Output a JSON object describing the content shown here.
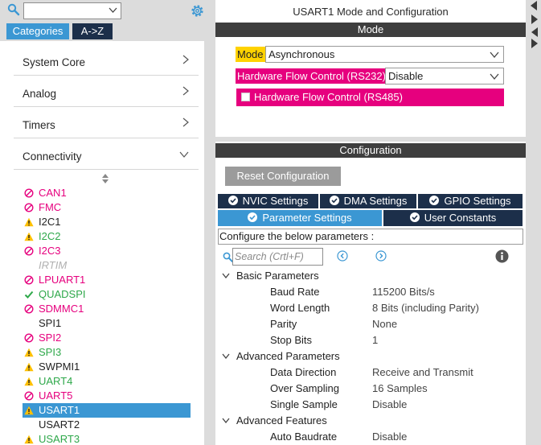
{
  "left": {
    "search": {
      "value": ""
    },
    "tabs": {
      "categories": "Categories",
      "az": "A->Z"
    },
    "categories": [
      {
        "label": "System Core",
        "state": "collapsed"
      },
      {
        "label": "Analog",
        "state": "collapsed"
      },
      {
        "label": "Timers",
        "state": "collapsed"
      },
      {
        "label": "Connectivity",
        "state": "expanded"
      }
    ],
    "peripherals": [
      {
        "label": "CAN1",
        "status": "disabled",
        "color": "#e6007e"
      },
      {
        "label": "FMC",
        "status": "disabled",
        "color": "#e6007e"
      },
      {
        "label": "I2C1",
        "status": "warning",
        "color": "#222222"
      },
      {
        "label": "I2C2",
        "status": "warning",
        "color": "#2ea84a"
      },
      {
        "label": "I2C3",
        "status": "disabled",
        "color": "#e6007e"
      },
      {
        "label": "IRTIM",
        "status": "none",
        "color": "#b0b0b0"
      },
      {
        "label": "LPUART1",
        "status": "disabled",
        "color": "#e6007e"
      },
      {
        "label": "QUADSPI",
        "status": "ok",
        "color": "#2ea84a"
      },
      {
        "label": "SDMMC1",
        "status": "disabled",
        "color": "#e6007e"
      },
      {
        "label": "SPI1",
        "status": "none",
        "color": "#222222"
      },
      {
        "label": "SPI2",
        "status": "disabled",
        "color": "#e6007e"
      },
      {
        "label": "SPI3",
        "status": "warning",
        "color": "#2ea84a"
      },
      {
        "label": "SWPMI1",
        "status": "warning",
        "color": "#222222"
      },
      {
        "label": "UART4",
        "status": "warning",
        "color": "#2ea84a"
      },
      {
        "label": "UART5",
        "status": "disabled",
        "color": "#e6007e"
      },
      {
        "label": "USART1",
        "status": "warning",
        "color": "#ffffff",
        "selected": true
      },
      {
        "label": "USART2",
        "status": "none",
        "color": "#222222"
      },
      {
        "label": "USART3",
        "status": "warning",
        "color": "#2ea84a"
      }
    ]
  },
  "mode_panel": {
    "title": "USART1 Mode and Configuration",
    "header": "Mode",
    "mode_label": "Mode",
    "mode_value": "Asynchronous",
    "hwfc232_label": "Hardware Flow Control (RS232)",
    "hwfc232_value": "Disable",
    "hwfc485_label": "Hardware Flow Control (RS485)"
  },
  "config_panel": {
    "header": "Configuration",
    "reset_label": "Reset Configuration",
    "tabs": {
      "nvic": "NVIC Settings",
      "dma": "DMA Settings",
      "gpio": "GPIO Settings",
      "params": "Parameter Settings",
      "user": "User Constants"
    },
    "description": "Configure the below parameters :",
    "search_placeholder": "Search (Crtl+F)",
    "groups": [
      {
        "title": "Basic Parameters",
        "rows": [
          {
            "name": "Baud Rate",
            "value": "115200 Bits/s"
          },
          {
            "name": "Word Length",
            "value": "8 Bits (including Parity)"
          },
          {
            "name": "Parity",
            "value": "None"
          },
          {
            "name": "Stop Bits",
            "value": "1"
          }
        ]
      },
      {
        "title": "Advanced Parameters",
        "rows": [
          {
            "name": "Data Direction",
            "value": "Receive and Transmit"
          },
          {
            "name": "Over Sampling",
            "value": "16 Samples"
          },
          {
            "name": "Single Sample",
            "value": "Disable"
          }
        ]
      },
      {
        "title": "Advanced Features",
        "rows": [
          {
            "name": "Auto Baudrate",
            "value": "Disable"
          }
        ]
      }
    ]
  },
  "colors": {
    "accent": "#3b97d3",
    "dark_tab": "#1c2f4a",
    "highlight_yellow": "#ffd200",
    "highlight_magenta": "#e6007e",
    "header_dark": "#3e3e3e"
  }
}
